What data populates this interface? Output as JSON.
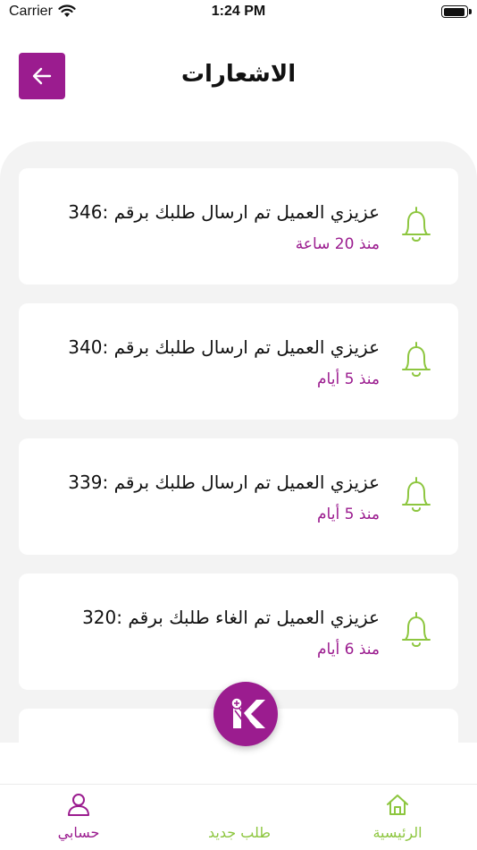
{
  "status_bar": {
    "carrier": "Carrier",
    "time": "1:24 PM",
    "battery_level": 0.95
  },
  "header": {
    "title": "الاشعارات",
    "back_icon": "arrow-left-icon"
  },
  "colors": {
    "accent": "#9b1c8f",
    "bell": "#8dc63f",
    "panel_bg": "#f3f3f3"
  },
  "notifications": [
    {
      "message": "عزيزي العميل تم ارسال طلبك برقم :346",
      "time": "منذ 20 ساعة",
      "icon": "bell-icon"
    },
    {
      "message": "عزيزي العميل تم ارسال طلبك برقم :340",
      "time": "منذ 5 أيام",
      "icon": "bell-icon"
    },
    {
      "message": "عزيزي العميل تم ارسال طلبك برقم :339",
      "time": "منذ 5 أيام",
      "icon": "bell-icon"
    },
    {
      "message": "عزيزي العميل تم الغاء طلبك برقم :320",
      "time": "منذ 6 أيام",
      "icon": "bell-icon"
    }
  ],
  "bottom_nav": {
    "home": {
      "label": "الرئيسية",
      "icon": "home-icon"
    },
    "new_order": {
      "label": "طلب جديد",
      "icon": "k-logo-icon"
    },
    "account": {
      "label": "حسابي",
      "icon": "user-icon"
    }
  }
}
